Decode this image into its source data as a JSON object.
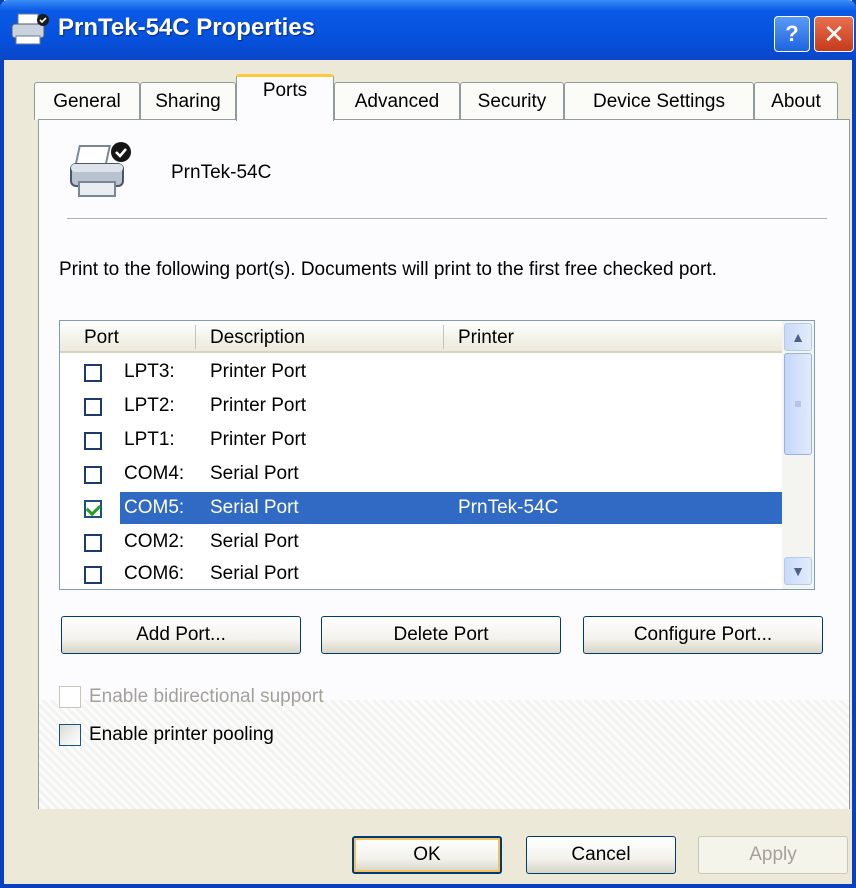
{
  "window": {
    "title": "PrnTek-54C Properties",
    "help_label": "?",
    "close_label": "✕",
    "title_icon": "printer-icon"
  },
  "tabs": [
    {
      "label": "General"
    },
    {
      "label": "Sharing"
    },
    {
      "label": "Ports"
    },
    {
      "label": "Advanced"
    },
    {
      "label": "Security"
    },
    {
      "label": "Device Settings"
    },
    {
      "label": "About"
    }
  ],
  "active_tab": "Ports",
  "printer": {
    "name": "PrnTek-54C",
    "icon": "printer-icon"
  },
  "instructions": "Print to the following port(s). Documents will print to the first free checked port.",
  "ports_list": {
    "columns": [
      "Port",
      "Description",
      "Printer"
    ],
    "rows": [
      {
        "port": "LPT3:",
        "description": "Printer Port",
        "printer": "",
        "checked": false
      },
      {
        "port": "LPT2:",
        "description": "Printer Port",
        "printer": "",
        "checked": false
      },
      {
        "port": "LPT1:",
        "description": "Printer Port",
        "printer": "",
        "checked": false
      },
      {
        "port": "COM4:",
        "description": "Serial Port",
        "printer": "",
        "checked": false
      },
      {
        "port": "COM5:",
        "description": "Serial Port",
        "printer": "PrnTek-54C",
        "checked": true
      },
      {
        "port": "COM2:",
        "description": "Serial Port",
        "printer": "",
        "checked": false
      },
      {
        "port": "COM6:",
        "description": "Serial Port",
        "printer": "",
        "checked": false
      }
    ],
    "selected_port": "COM5:"
  },
  "port_buttons": {
    "add": "Add Port...",
    "delete": "Delete Port",
    "configure": "Configure Port..."
  },
  "options": {
    "bidirectional": {
      "label": "Enable bidirectional support",
      "checked": false,
      "enabled": false
    },
    "pooling": {
      "label": "Enable printer pooling",
      "checked": false,
      "enabled": true
    }
  },
  "dialog_buttons": {
    "ok": "OK",
    "cancel": "Cancel",
    "apply": "Apply"
  },
  "colors": {
    "titlebar": "#0552df",
    "selection": "#316ac5",
    "active_tab_accent": "#ffc83c"
  }
}
